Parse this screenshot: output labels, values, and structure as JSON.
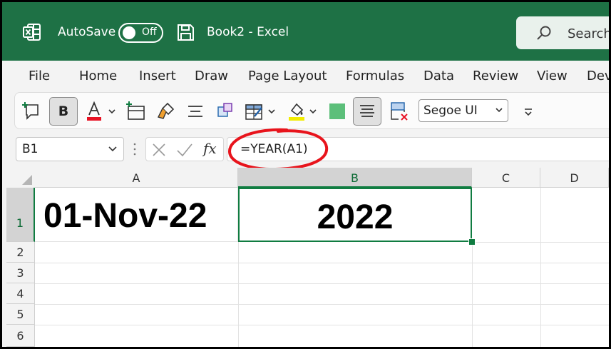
{
  "title_bar": {
    "autosave_label": "AutoSave",
    "autosave_state": "Off",
    "document_title": "Book2  -  Excel",
    "search_placeholder": "Search"
  },
  "menu": {
    "items": [
      "File",
      "Home",
      "Insert",
      "Draw",
      "Page Layout",
      "Formulas",
      "Data",
      "Review",
      "View",
      "Developer"
    ]
  },
  "toolbar": {
    "bold_label": "B",
    "font_name": "Segoe UI",
    "fill_color": "#5cbf7a",
    "font_color_underline": "#e81123",
    "highlight_color": "#f2ec00"
  },
  "formula_bar": {
    "name_box": "B1",
    "fx_label": "fx",
    "formula": "=YEAR(A1)"
  },
  "grid": {
    "columns": [
      "A",
      "B",
      "C",
      "D"
    ],
    "rows": [
      "1",
      "2",
      "3",
      "4",
      "5",
      "6"
    ],
    "cells": {
      "A1": "01-Nov-22",
      "B1": "2022"
    },
    "selected_cell": "B1"
  },
  "colors": {
    "excel_green": "#1e7145",
    "selection_green": "#107c41",
    "annotation_red": "#e8141c"
  }
}
